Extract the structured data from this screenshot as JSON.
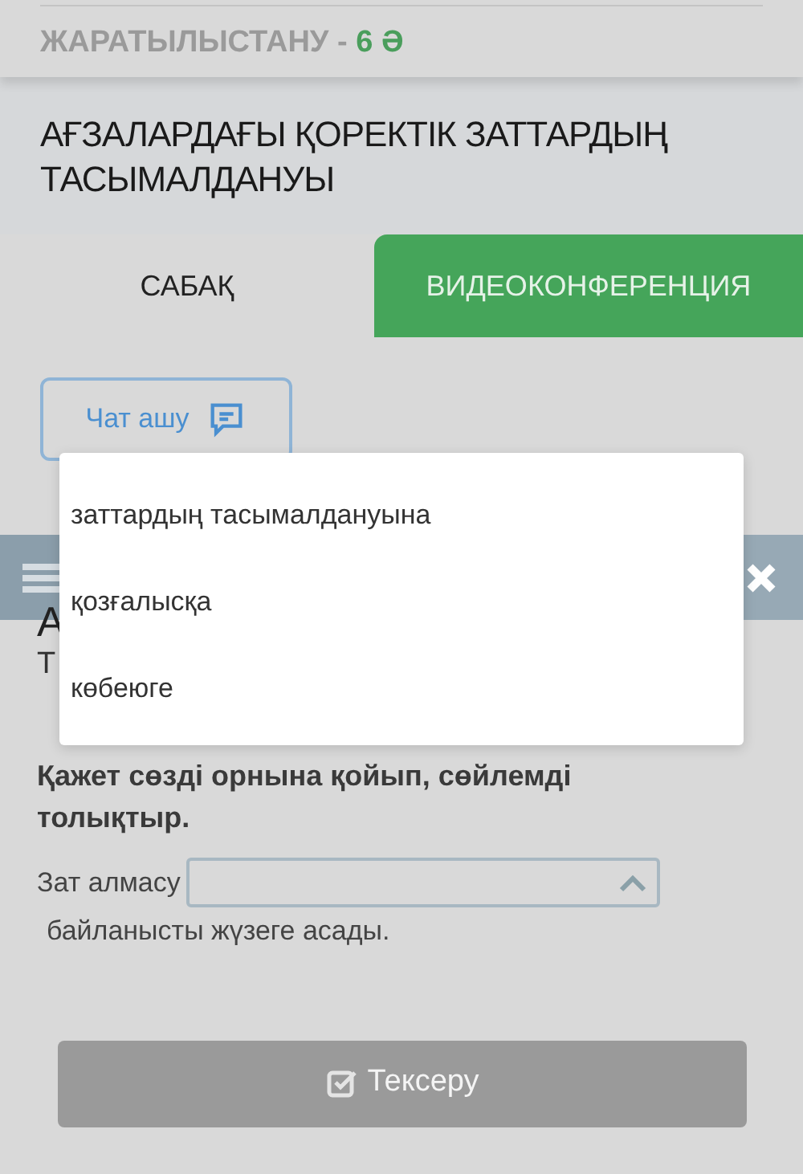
{
  "subject": {
    "name": "ЖАРАТЫЛЫСТАНУ - ",
    "grade": "6 Ә"
  },
  "lesson_title": "АҒЗАЛАРДАҒЫ ҚОРЕКТІК ЗАТТАРДЫҢ ТАСЫМАЛДАНУЫ",
  "tabs": [
    {
      "label": "САБАҚ",
      "selected": true
    },
    {
      "label": "ВИДЕОКОНФЕРЕНЦИЯ",
      "selected": false
    }
  ],
  "chat_button": "Чат ашу",
  "question_fragments": [
    "А",
    "Т"
  ],
  "instruction": "Қажет сөзді орнына қойып, сөйлемді толықтыр.",
  "sentence": {
    "before": "Зат алмасу",
    "after": "байланысты жүзеге асады.",
    "expanded": true,
    "options": [
      "заттардың тасымалдануына",
      "қозғалысқа",
      "көбеюге"
    ]
  },
  "check_button": {
    "label": "Тексеру",
    "disabled": true
  }
}
